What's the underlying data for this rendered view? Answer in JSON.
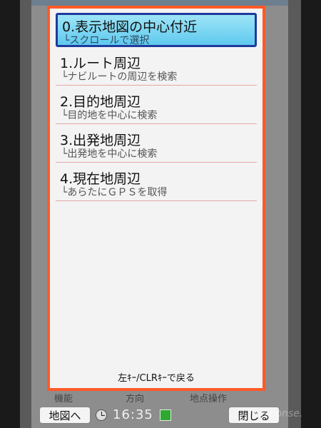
{
  "menu": {
    "items": [
      {
        "title": "0.表示地図の中心付近",
        "sub": "└スクロールで選択"
      },
      {
        "title": "1.ルート周辺",
        "sub": "└ナビルートの周辺を検索"
      },
      {
        "title": "2.目的地周辺",
        "sub": "└目的地を中心に検索"
      },
      {
        "title": "3.出発地周辺",
        "sub": "└出発地を中心に検索"
      },
      {
        "title": "4.現在地周辺",
        "sub": "└あらたにＧＰＳを取得"
      }
    ],
    "hint": "左ｷｰ/CLRｷｰで戻る"
  },
  "background": {
    "tabs": [
      "機能",
      "方向",
      "地点操作"
    ]
  },
  "softkeys": {
    "left": "地図へ",
    "right": "閉じる",
    "time": "16:35"
  },
  "icons": {
    "clock": "clock-icon",
    "battery": "battery-icon"
  },
  "colors": {
    "panel_border": "#ff5a28",
    "selection_fill": "#5fc9ee",
    "selection_border": "#1e3a9c"
  },
  "watermark": "response."
}
